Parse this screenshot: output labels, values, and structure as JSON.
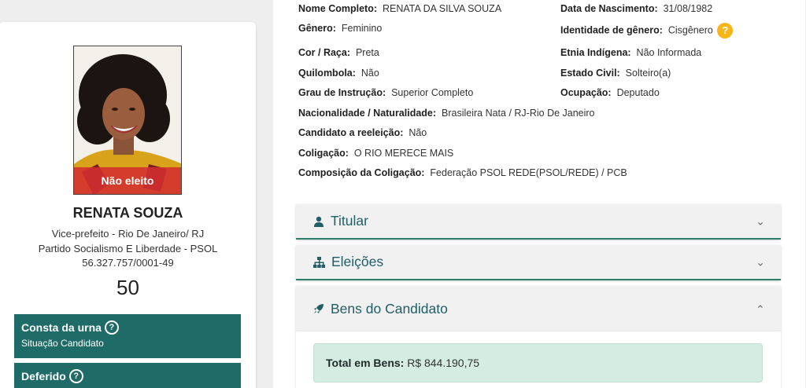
{
  "candidate": {
    "photo_banner": "Não eleito",
    "name": "RENATA SOUZA",
    "office": "Vice-prefeito - Rio De Janeiro/ RJ",
    "party": "Partido Socialismo E Liberdade - PSOL",
    "cnpj": "56.327.757/0001-49",
    "number": "50"
  },
  "status_cards": [
    {
      "title": "Consta da urna",
      "subtitle": "Situação Candidato"
    },
    {
      "title": "Deferido",
      "subtitle": ""
    }
  ],
  "details": {
    "nome_label": "Nome Completo:",
    "nome": "RENATA DA SILVA SOUZA",
    "nasc_label": "Data de Nascimento:",
    "nasc": "31/08/1982",
    "genero_label": "Gênero:",
    "genero": "Feminino",
    "ident_label": "Identidade de gênero:",
    "ident": "Cisgênero",
    "cor_label": "Cor / Raça:",
    "cor": "Preta",
    "etnia_label": "Etnia Indígena:",
    "etnia": "Não Informada",
    "quil_label": "Quilombola:",
    "quil": "Não",
    "civil_label": "Estado Civil:",
    "civil": "Solteiro(a)",
    "grau_label": "Grau de Instrução:",
    "grau": "Superior Completo",
    "ocup_label": "Ocupação:",
    "ocup": "Deputado",
    "nac_label": "Nacionalidade / Naturalidade:",
    "nac": "Brasileira Nata / RJ-Rio De Janeiro",
    "reel_label": "Candidato a reeleição:",
    "reel": "Não",
    "colig_label": "Coligação:",
    "colig": "O RIO MERECE MAIS",
    "comp_label": "Composição da Coligação:",
    "comp": "Federação PSOL REDE(PSOL/REDE) / PCB"
  },
  "accordions": {
    "titular": "Titular",
    "eleicoes": "Eleições",
    "bens": "Bens do Candidato"
  },
  "bens": {
    "total_label": "Total em Bens:",
    "total_value": "R$ 844.190,75"
  },
  "icons": {
    "help": "question-circle-icon",
    "titular": "user-icon",
    "eleicoes": "sitemap-icon",
    "bens": "rocket-icon"
  },
  "colors": {
    "status_bg": "#1f6b67",
    "accent": "#215e66",
    "warning": "#f9b418",
    "banner": "#d32f2f",
    "total_bg": "#d4ece1"
  }
}
